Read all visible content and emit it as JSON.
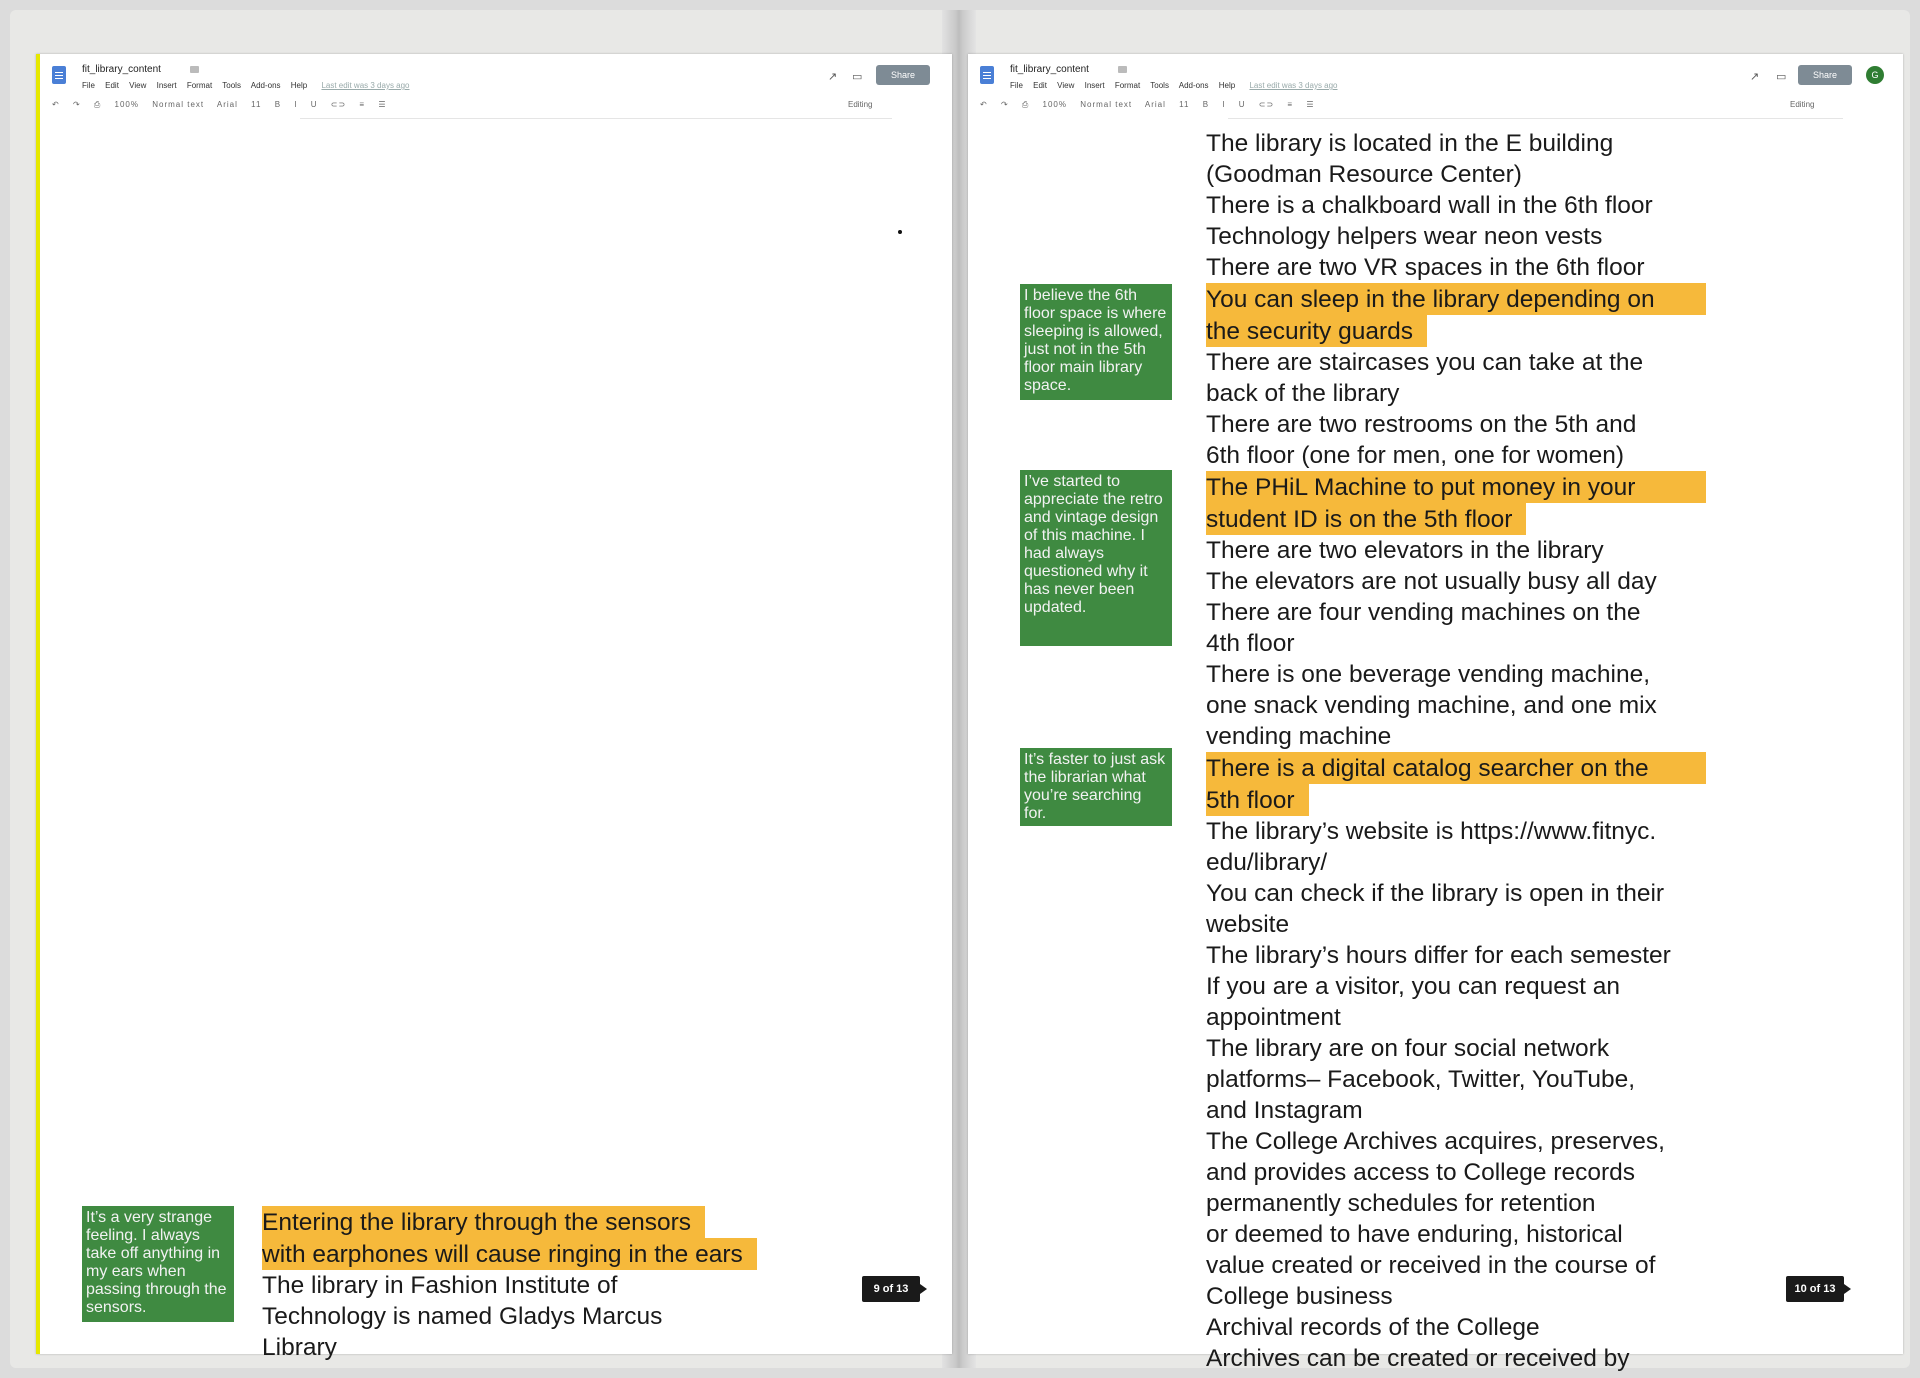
{
  "doc": {
    "title": "fit_library_content",
    "menus": [
      "File",
      "Edit",
      "View",
      "Insert",
      "Format",
      "Tools",
      "Add-ons",
      "Help"
    ],
    "last_edit": "Last edit was 3 days ago",
    "share_label": "Share",
    "avatar_initial": "G",
    "editing_mode": "Editing",
    "toolbar_zoom": "100%",
    "toolbar_style": "Normal text",
    "toolbar_font": "Arial",
    "toolbar_size": "11"
  },
  "left_page": {
    "note": "It’s a very strange feeling. I always take off anything in my ears when passing through the sensors.",
    "highlight_1": "Entering the library through the sensors",
    "highlight_2": "with earphones will cause ringing in the ears",
    "line_1": "The library in Fashion Institute of",
    "line_2": "Technology is named Gladys Marcus",
    "line_3": "Library",
    "page_number": "9 of 13"
  },
  "right_page": {
    "lines": [
      "The library is located in the E building",
      "(Goodman Resource Center)",
      "There is a chalkboard wall in the 6th floor",
      "Technology helpers wear neon vests",
      "There are two VR spaces in the 6th floor"
    ],
    "hl_sleep_1": "You can sleep in the library depending on",
    "hl_sleep_2": "the security guards",
    "lines_2": [
      "There are staircases you can take at the",
      "back of the library",
      "There are two restrooms on the 5th and",
      "6th floor (one for men, one for women)"
    ],
    "hl_phil_1": "The PHiL Machine to put money in your",
    "hl_phil_2": "student ID is on the 5th floor",
    "lines_3": [
      "There are two elevators in the library",
      "The elevators are not usually busy all day",
      "There are four vending machines on the",
      "4th floor",
      "There is one beverage vending machine,",
      "one snack vending machine, and one mix",
      "vending machine"
    ],
    "hl_catalog_1": "There is a digital catalog searcher on the",
    "hl_catalog_2": "5th floor",
    "lines_4": [
      "The library’s website is https://www.fitnyc.",
      "edu/library/",
      "You can check if the library is open in their",
      "website",
      "The library’s hours differ for each semester",
      "If you are a visitor, you can request an",
      "appointment",
      "The library are on four social network",
      "platforms– Facebook, Twitter, YouTube,",
      "and Instagram",
      "The College Archives acquires, preserves,",
      "and provides access to College records",
      "permanently schedules for retention",
      "or deemed to have enduring, historical",
      "value created or received in the course of",
      "College business",
      "Archival records of the College",
      "Archives can be created or received by"
    ],
    "notes": [
      "I believe the 6th floor space is where sleeping is allowed, just not in the 5th floor main library space.",
      "I’ve started to appreciate the retro and vintage design of this machine. I had always questioned why it has never been updated.",
      "It’s faster to just ask the librarian what you’re searching for."
    ],
    "page_number": "10 of 13"
  }
}
